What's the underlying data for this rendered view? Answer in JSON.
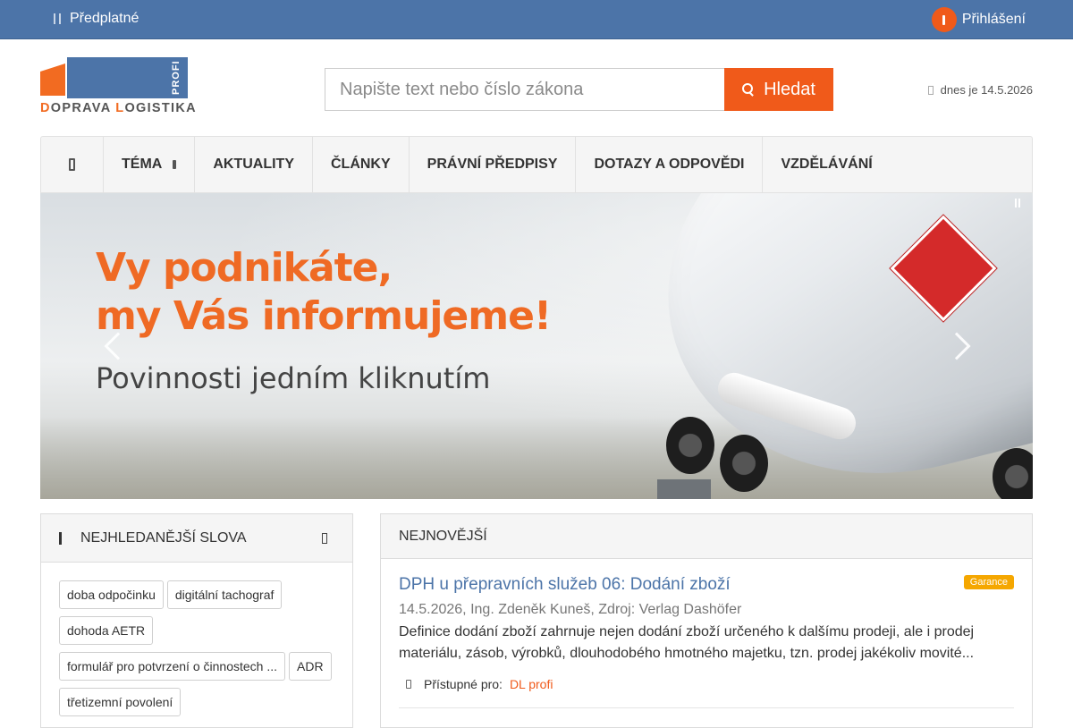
{
  "topbar": {
    "subscription_label": "Předplatné",
    "login_label": "Přihlášení"
  },
  "logo": {
    "profi": "PROFI",
    "brand_d": "D",
    "brand_rest1": "OPRAVA ",
    "brand_l": "L",
    "brand_rest2": "OGISTIKA"
  },
  "search": {
    "placeholder": "Napište text nebo číslo zákona",
    "button_label": "Hledat"
  },
  "today_label": "dnes je 14.5.2026",
  "nav": {
    "items": [
      {
        "label": "TÉMA"
      },
      {
        "label": "AKTUALITY"
      },
      {
        "label": "ČLÁNKY"
      },
      {
        "label": "PRÁVNÍ PŘEDPISY"
      },
      {
        "label": "DOTAZY A ODPOVĚDI"
      },
      {
        "label": "VZDĚLÁVÁNÍ"
      }
    ]
  },
  "banner": {
    "line1": "Vy podnikáte,",
    "line2": "my Vás informujeme!",
    "line3": "Povinnosti jedním kliknutím"
  },
  "keywords": {
    "title": "NEJHLEDANĚJŠÍ SLOVA",
    "tags": [
      "doba odpočinku",
      "digitální tachograf",
      "dohoda AETR",
      "formulář pro potvrzení o činnostech ...",
      "ADR",
      "třetizemní povolení"
    ]
  },
  "latest": {
    "title": "NEJNOVĚJŠÍ",
    "article": {
      "title": "DPH u přepravních služeb 06: Dodání zboží",
      "badge": "Garance",
      "meta": "14.5.2026, Ing. Zdeněk Kuneš, Zdroj: Verlag Dashöfer",
      "description": "Definice dodání zboží zahrnuje nejen dodání zboží určeného k dalšímu prodeji, ale i prodej materiálu, zásob, výrobků, dlouhodobého hmotného majetku, tzn. prodej jakékoliv movité...",
      "access_label": "Přístupné pro:",
      "access_link": "DL profi"
    }
  },
  "colors": {
    "topbar": "#4c74a8",
    "accent": "#f05a1a",
    "link": "#4c74a8",
    "badge": "#f5a700"
  }
}
